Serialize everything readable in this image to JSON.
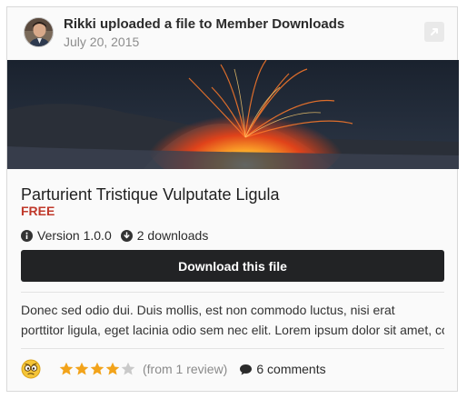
{
  "header": {
    "avatar_icon": "user-avatar",
    "title": "Rikki uploaded a file to Member Downloads",
    "date": "July 20, 2015",
    "expand_icon": "expand-arrow-icon"
  },
  "file": {
    "cover_alt": "volcano-cover-image",
    "title": "Parturient Tristique Vulputate Ligula",
    "price": "FREE",
    "version": "Version 1.0.0",
    "downloads": "2 downloads",
    "download_label": "Download this file",
    "description_lines": [
      "Donec sed odio dui. Duis mollis, est non commodo luctus, nisi erat",
      "porttitor ligula, eget lacinia odio sem nec elit. Lorem ipsum dolor sit amet, conse.."
    ]
  },
  "footer": {
    "reaction_icon": "confused-emoji-icon",
    "rating": 4,
    "rating_max": 5,
    "reviews": "(from 1 review)",
    "comments": "6 comments"
  },
  "colors": {
    "price": "#c0392b",
    "button_bg": "#222325",
    "star_filled": "#f2a31a",
    "star_empty": "#c9c9c9"
  }
}
